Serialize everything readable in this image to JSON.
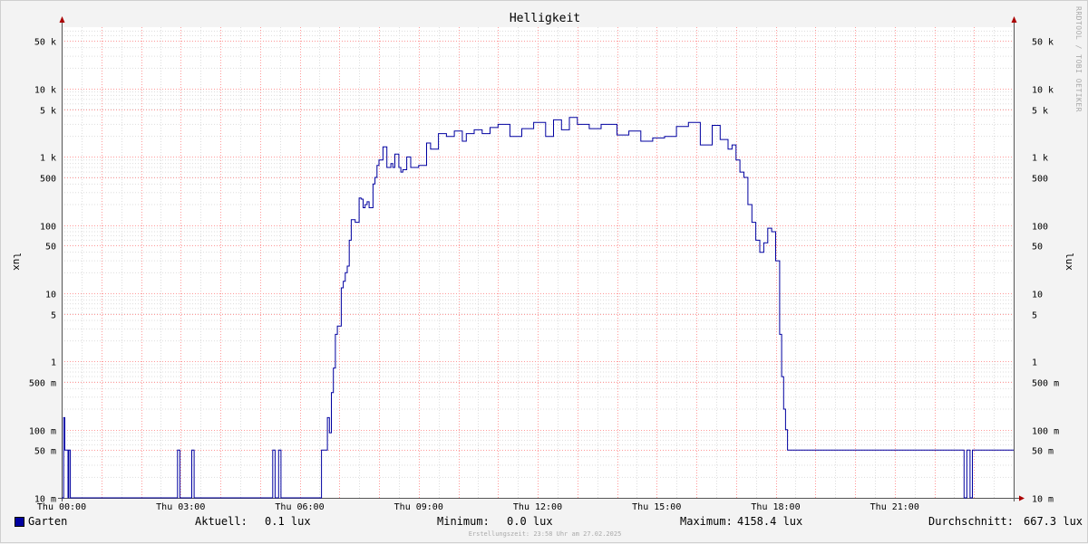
{
  "chart_data": {
    "type": "line",
    "title": "Helligkeit",
    "ylabel": "lux",
    "yscale": "log",
    "ylim": [
      0.01,
      80000
    ],
    "y_ticks": [
      {
        "value": 0.01,
        "label": "10 m"
      },
      {
        "value": 0.05,
        "label": "50 m"
      },
      {
        "value": 0.1,
        "label": "100 m"
      },
      {
        "value": 0.5,
        "label": "500 m"
      },
      {
        "value": 1,
        "label": "1"
      },
      {
        "value": 5,
        "label": "5"
      },
      {
        "value": 10,
        "label": "10"
      },
      {
        "value": 50,
        "label": "50"
      },
      {
        "value": 100,
        "label": "100"
      },
      {
        "value": 500,
        "label": "500"
      },
      {
        "value": 1000,
        "label": "1 k"
      },
      {
        "value": 5000,
        "label": "5 k"
      },
      {
        "value": 10000,
        "label": "10 k"
      },
      {
        "value": 50000,
        "label": "50 k"
      }
    ],
    "xlim": [
      0,
      24
    ],
    "x_ticks": [
      {
        "value": 0,
        "label": "Thu 00:00"
      },
      {
        "value": 3,
        "label": "Thu 03:00"
      },
      {
        "value": 6,
        "label": "Thu 06:00"
      },
      {
        "value": 9,
        "label": "Thu 09:00"
      },
      {
        "value": 12,
        "label": "Thu 12:00"
      },
      {
        "value": 15,
        "label": "Thu 15:00"
      },
      {
        "value": 18,
        "label": "Thu 18:00"
      },
      {
        "value": 21,
        "label": "Thu 21:00"
      }
    ],
    "grid": true,
    "series": [
      {
        "name": "Garten",
        "color": "#0000a0",
        "x": [
          0.0,
          0.05,
          0.08,
          0.12,
          0.16,
          0.18,
          0.2,
          0.22,
          0.24,
          0.28,
          0.3,
          1.0,
          2.0,
          2.9,
          2.92,
          2.95,
          2.98,
          3.0,
          3.05,
          3.25,
          3.28,
          3.31,
          3.34,
          4.0,
          5.0,
          5.3,
          5.32,
          5.35,
          5.38,
          5.45,
          5.47,
          5.5,
          5.53,
          5.55,
          6.0,
          6.5,
          6.55,
          6.65,
          6.7,
          6.75,
          6.8,
          6.85,
          6.9,
          6.95,
          7.0,
          7.05,
          7.1,
          7.15,
          7.2,
          7.25,
          7.3,
          7.4,
          7.5,
          7.55,
          7.6,
          7.65,
          7.7,
          7.75,
          7.85,
          7.9,
          7.95,
          8.0,
          8.1,
          8.2,
          8.3,
          8.35,
          8.4,
          8.5,
          8.55,
          8.6,
          8.7,
          8.8,
          9.0,
          9.2,
          9.3,
          9.5,
          9.7,
          9.9,
          10.1,
          10.2,
          10.4,
          10.6,
          10.8,
          11.0,
          11.3,
          11.6,
          11.9,
          12.2,
          12.4,
          12.6,
          12.8,
          13.0,
          13.3,
          13.6,
          14.0,
          14.3,
          14.6,
          14.9,
          15.2,
          15.5,
          15.8,
          16.1,
          16.4,
          16.6,
          16.8,
          16.9,
          17.0,
          17.1,
          17.2,
          17.3,
          17.4,
          17.5,
          17.6,
          17.7,
          17.8,
          17.9,
          18.0,
          18.1,
          18.15,
          18.2,
          18.25,
          18.3,
          18.35,
          18.4,
          18.5,
          19.0,
          20.0,
          21.0,
          22.0,
          22.7,
          22.75,
          22.78,
          22.82,
          22.86,
          22.9,
          22.93,
          22.96,
          23.0,
          24.0
        ],
        "y": [
          0.01,
          0.15,
          0.05,
          0.05,
          0.01,
          0.05,
          0.05,
          0.01,
          0.01,
          0.01,
          0.01,
          0.01,
          0.01,
          0.01,
          0.05,
          0.05,
          0.01,
          0.01,
          0.01,
          0.01,
          0.05,
          0.05,
          0.01,
          0.01,
          0.01,
          0.01,
          0.05,
          0.05,
          0.01,
          0.01,
          0.05,
          0.05,
          0.01,
          0.01,
          0.01,
          0.01,
          0.05,
          0.05,
          0.15,
          0.09,
          0.35,
          0.8,
          2.5,
          3.3,
          3.3,
          12,
          15,
          20,
          25,
          60,
          120,
          110,
          250,
          240,
          180,
          200,
          220,
          180,
          400,
          500,
          750,
          900,
          1400,
          700,
          800,
          700,
          1100,
          700,
          600,
          650,
          1000,
          700,
          750,
          1600,
          1300,
          2200,
          2000,
          2400,
          1700,
          2200,
          2500,
          2200,
          2700,
          3000,
          2000,
          2600,
          3200,
          2000,
          3500,
          2500,
          3800,
          3000,
          2600,
          3000,
          2100,
          2400,
          1700,
          1900,
          2000,
          2800,
          3200,
          1500,
          2900,
          1800,
          1300,
          1500,
          900,
          600,
          500,
          200,
          110,
          60,
          40,
          55,
          90,
          80,
          30,
          2.5,
          0.6,
          0.2,
          0.1,
          0.05,
          0.05,
          0.05,
          0.05,
          0.05,
          0.05,
          0.05,
          0.05,
          0.05,
          0.01,
          0.01,
          0.05,
          0.05,
          0.01,
          0.01,
          0.05,
          0.05,
          0.05
        ]
      }
    ]
  },
  "legend": {
    "series_name": "Garten",
    "current_label": "Aktuell:",
    "current_value": "0.1 lux",
    "min_label": "Minimum:",
    "min_value": "0.0 lux",
    "max_label": "Maximum:",
    "max_value": "4158.4 lux",
    "avg_label": "Durchschnitt:",
    "avg_value": "667.3 lux"
  },
  "footer": "Erstellungszeit: 23:58 Uhr am 27.02.2025",
  "watermark": "RRDTOOL / TOBI OETIKER",
  "colors": {
    "line": "#0000a0",
    "major_grid": "#ff9999",
    "minor_grid": "#dddddd",
    "background": "#f3f3f3",
    "plot_background": "#ffffff",
    "axis_arrow": "#aa0000"
  }
}
